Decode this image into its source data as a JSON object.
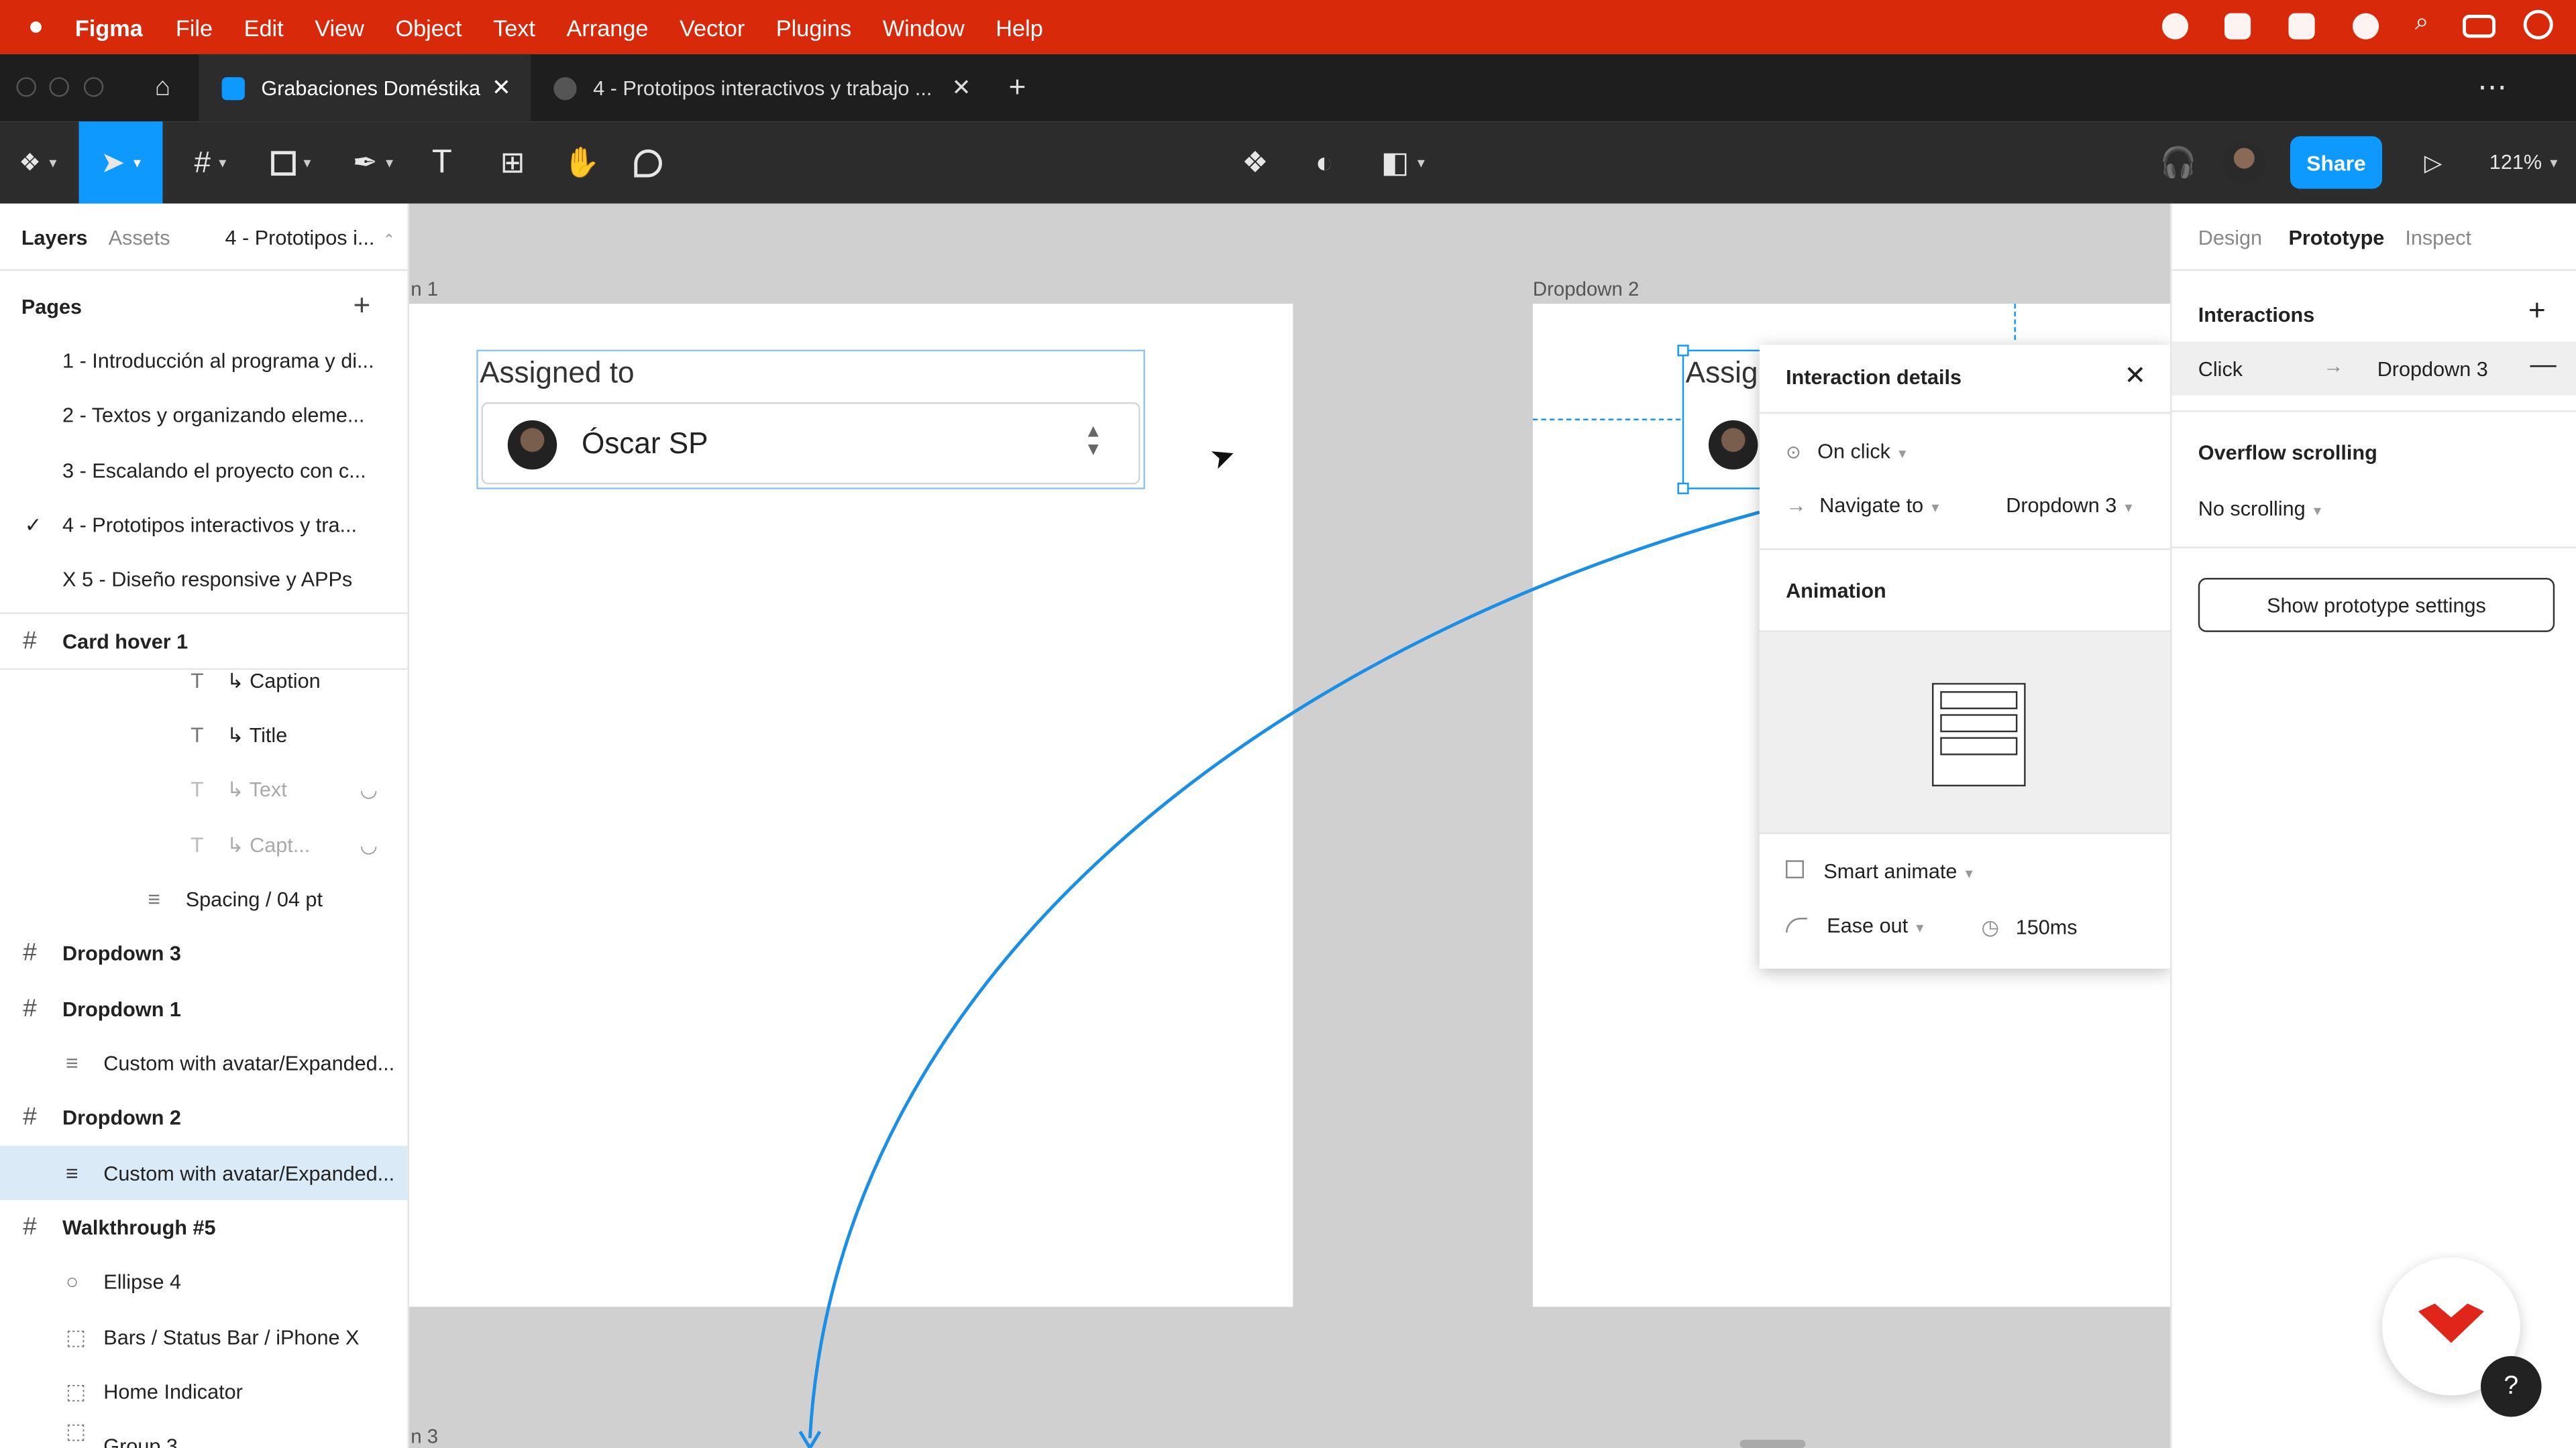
{
  "menubar": {
    "app_name": "Figma",
    "items": [
      "File",
      "Edit",
      "View",
      "Object",
      "Text",
      "Arrange",
      "Vector",
      "Plugins",
      "Window",
      "Help"
    ]
  },
  "tabs": {
    "active_tab": "Grabaciones Doméstika",
    "second_tab": "4 - Prototipos interactivos y trabajo ...",
    "new_tab_symbol": "+",
    "more_symbol": "⋯"
  },
  "toolbar": {
    "share_label": "Share",
    "zoom": "121%",
    "text_tool_glyph": "T"
  },
  "left_panel": {
    "tab_layers": "Layers",
    "tab_assets": "Assets",
    "page_selector": "4 - Prototipos i...",
    "pages_title": "Pages",
    "pages": [
      "1 - Introducción al programa y di...",
      "2 - Textos y organizando eleme...",
      "3 - Escalando el proyecto con c...",
      "4 - Prototipos interactivos y tra...",
      "X 5 - Diseño responsive y APPs"
    ],
    "layers": [
      "Card hover 1",
      "↳ Caption",
      "↳ Title",
      "↳ Text",
      "↳ Capt...",
      "Spacing / 04 pt",
      "Dropdown 3",
      "Dropdown 1",
      "Custom with avatar/Expanded...",
      "Dropdown 2",
      "Custom with avatar/Expanded...",
      "Walkthrough #5",
      "Ellipse 4",
      "Bars / Status Bar / iPhone X",
      "Home Indicator",
      "Group 3"
    ]
  },
  "canvas": {
    "frame1_label": "n 1",
    "frame2_label": "Dropdown 2",
    "frame3_label": "n 3",
    "assigned_label": "Assigned to",
    "assigned_label_partial": "Assig",
    "assignee_name": "Óscar SP"
  },
  "interaction_popup": {
    "title": "Interaction details",
    "trigger": "On click",
    "action": "Navigate to",
    "destination": "Dropdown 3",
    "animation_title": "Animation",
    "animation_type": "Smart animate",
    "easing": "Ease out",
    "duration": "150ms"
  },
  "right_panel": {
    "tab_design": "Design",
    "tab_prototype": "Prototype",
    "tab_inspect": "Inspect",
    "interactions_title": "Interactions",
    "interaction_trigger": "Click",
    "interaction_destination": "Dropdown 3",
    "overflow_title": "Overflow scrolling",
    "overflow_value": "No scrolling",
    "prototype_settings_button": "Show prototype settings"
  },
  "help_button": "?",
  "colors": {
    "menubar": "#d82a0a",
    "accent_blue": "#0d99ff",
    "selection": "#daebf7",
    "connector": "#1b8fe6"
  }
}
